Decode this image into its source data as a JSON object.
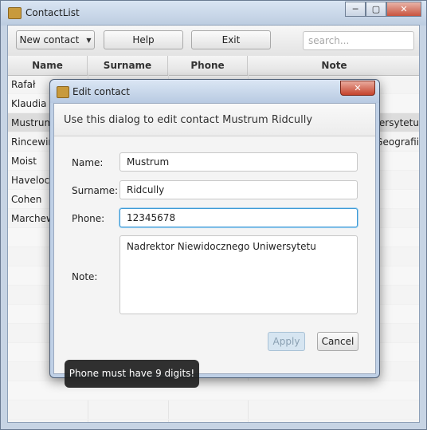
{
  "window": {
    "title": "ContactList",
    "buttons": {
      "minimize": "─",
      "maximize": "▢",
      "close": "✕"
    }
  },
  "toolbar": {
    "new_contact": "New contact",
    "help": "Help",
    "exit": "Exit",
    "search_placeholder": "search..."
  },
  "table": {
    "columns": [
      "Name",
      "Surname",
      "Phone",
      "Note"
    ],
    "rows": [
      {
        "name": "Rafał",
        "surname": "",
        "phone": "",
        "note": ""
      },
      {
        "name": "Klaudia",
        "surname": "",
        "phone": "",
        "note": ""
      },
      {
        "name": "Mustrum",
        "surname": "",
        "phone": "",
        "note": "wersytetu"
      },
      {
        "name": "Rincewind",
        "surname": "",
        "phone": "",
        "note": "Geografii"
      },
      {
        "name": "Moist",
        "surname": "",
        "phone": "",
        "note": ""
      },
      {
        "name": "Havelock",
        "surname": "",
        "phone": "",
        "note": ""
      },
      {
        "name": "Cohen",
        "surname": "",
        "phone": "",
        "note": ""
      },
      {
        "name": "Marchew",
        "surname": "",
        "phone": "",
        "note": ""
      }
    ],
    "selected_row": 2
  },
  "dialog": {
    "title": "Edit contact",
    "close_glyph": "✕",
    "header": "Use this dialog to edit contact Mustrum  Ridcully",
    "labels": {
      "name": "Name:",
      "surname": "Surname:",
      "phone": "Phone:",
      "note": "Note:"
    },
    "values": {
      "name": "Mustrum",
      "surname": "Ridcully",
      "phone": "12345678",
      "note": "Nadrektor Niewidocznego Uniwersytetu"
    },
    "apply": "Apply",
    "cancel": "Cancel",
    "focused_field": "phone"
  },
  "tooltip": "Phone must have 9 digits!",
  "icons": {
    "app": "app-icon",
    "dropdown": "chevron-down-icon"
  }
}
